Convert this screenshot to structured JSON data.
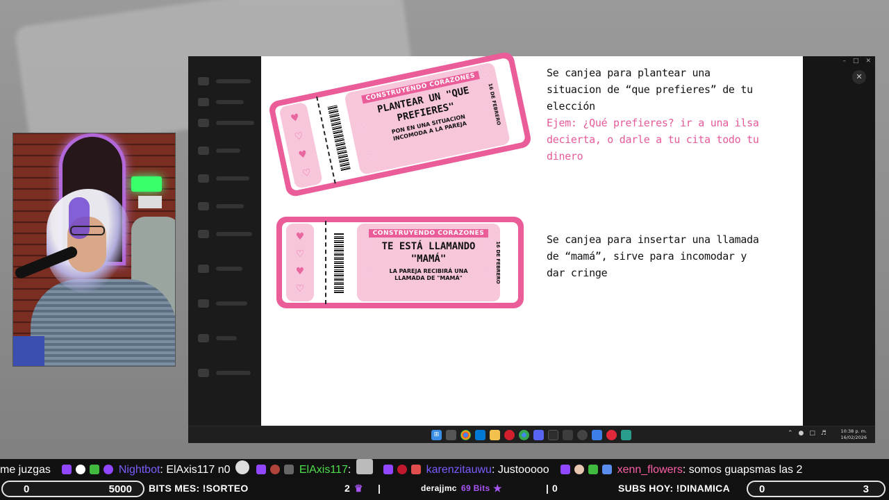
{
  "slide": {
    "tickets": [
      {
        "banner": "CONSTRUYENDO CORAZONES",
        "title_line1": "PLANTEAR UN \"QUE",
        "title_line2": "PREFIERES\"",
        "sub_line1": "PON EN UNA SITUACION",
        "sub_line2": "INCOMODA A LA PAREJA",
        "date": "16 DE FEBRERO"
      },
      {
        "banner": "CONSTRUYENDO CORAZONES",
        "title_line1": "TE ESTÁ LLAMANDO",
        "title_line2": "\"MAMÁ\"",
        "sub_line1": "LA PAREJA RECIBIRÁ UNA",
        "sub_line2": "LLAMADA DE \"MAMÁ\"",
        "date": "16 DE FEBRERO"
      }
    ],
    "descriptions": [
      {
        "line1": "Se canjea para plantear una",
        "line2": "situacion de “que prefieres” de tu",
        "line3": "elección",
        "example1": "Ejem: ¿Qué prefieres? ir a una ilsa",
        "example2": "decierta, o darle a tu cita todo tu",
        "example3": "dinero"
      },
      {
        "line1": "Se canjea para insertar una llamada",
        "line2": "de “mamá”, sirve para incomodar y",
        "line3": "dar cringe"
      }
    ]
  },
  "taskbar": {
    "time": "10:38 p. m.",
    "date": "16/02/2026"
  },
  "chat": {
    "messages": [
      {
        "user": "",
        "text": "me juzgas",
        "user_color": "#ffffff"
      },
      {
        "user": "Nightbot",
        "text": "ElAxis117 n0",
        "user_color": "#7b5cff"
      },
      {
        "user": "ElAxis117",
        "text": "",
        "user_color": "#4ddf4d"
      },
      {
        "user": "karenzitauwu",
        "text": "Justooooo",
        "user_color": "#7b5cff"
      },
      {
        "user": "xenn_flowers",
        "text": "somos guapsmas las 2",
        "user_color": "#ff5fa8"
      }
    ]
  },
  "bottom_bar": {
    "bits_min": "0",
    "bits_max": "5000",
    "bits_label": "BITS MES: !SORTEO",
    "subs_count": "2",
    "last_cheer_user": "derajjmc",
    "last_cheer_amount": "69 Bits",
    "cheer_count": "0",
    "subs_label": "SUBS HOY: !DINAMICA",
    "subs_min": "0",
    "subs_max": "3"
  },
  "colors": {
    "ticket_pink": "#ea5d99",
    "ticket_light": "#f7c6db",
    "example_text": "#e55a9a"
  }
}
